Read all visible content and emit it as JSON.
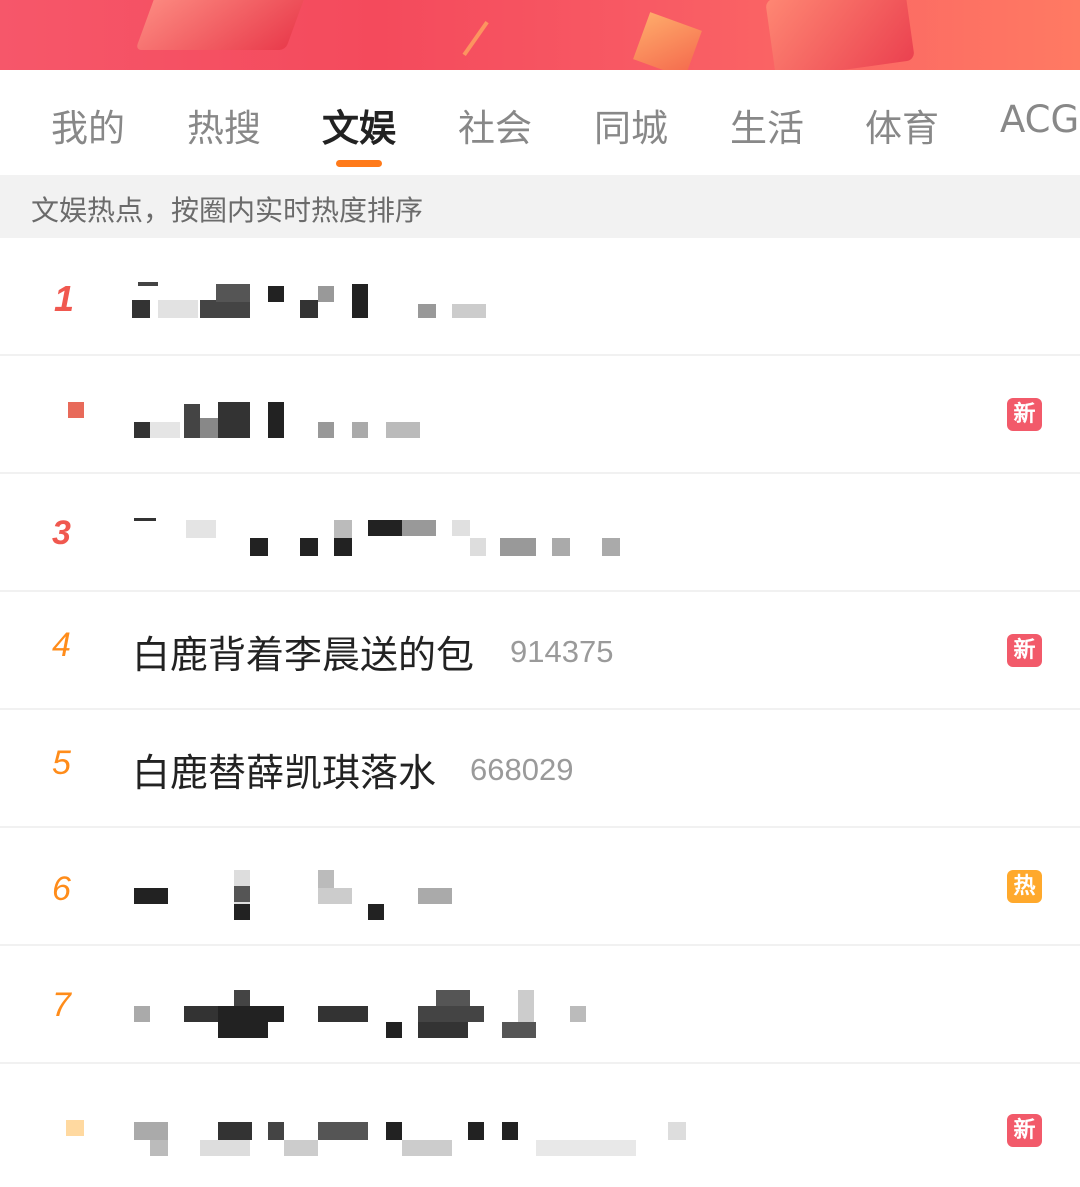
{
  "tabs": [
    {
      "label": "我的"
    },
    {
      "label": "热搜"
    },
    {
      "label": "文娱",
      "active": true
    },
    {
      "label": "社会"
    },
    {
      "label": "同城"
    },
    {
      "label": "生活"
    },
    {
      "label": "体育"
    },
    {
      "label": "ACG"
    }
  ],
  "subtitle": "文娱热点，按圈内实时热度排序",
  "accent_color": "#ff7a1a",
  "items": [
    {
      "rank": "1",
      "title": "",
      "heat": "",
      "badge": "",
      "censored": true
    },
    {
      "rank": "2",
      "title": "",
      "heat": "",
      "badge": "新",
      "censored": true
    },
    {
      "rank": "3",
      "title": "",
      "heat": "",
      "badge": "",
      "censored": true
    },
    {
      "rank": "4",
      "title": "白鹿背着李晨送的包",
      "heat": "914375",
      "badge": "新",
      "censored": false
    },
    {
      "rank": "5",
      "title": "白鹿替薛凯琪落水",
      "heat": "668029",
      "badge": "",
      "censored": false
    },
    {
      "rank": "6",
      "title": "",
      "heat": "",
      "badge": "热",
      "censored": true
    },
    {
      "rank": "7",
      "title": "",
      "heat": "",
      "badge": "",
      "censored": true
    },
    {
      "rank": "8",
      "title": "",
      "heat": "",
      "badge": "新",
      "censored": true
    }
  ]
}
